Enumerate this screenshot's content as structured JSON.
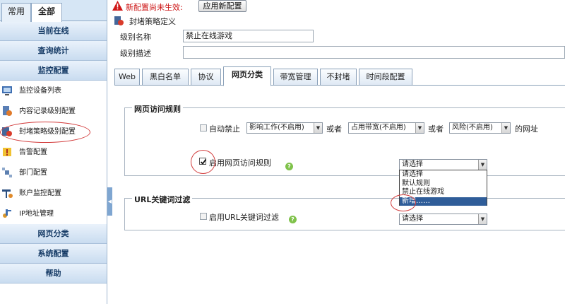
{
  "sidebar": {
    "tabs": [
      "常用",
      "全部"
    ],
    "sections": {
      "online": "当前在线",
      "stats": "查询统计",
      "monitor": "监控配置",
      "web_category": "网页分类",
      "system": "系统配置",
      "help": "帮助"
    },
    "items": [
      {
        "label": "监控设备列表",
        "icon": "monitor-icon"
      },
      {
        "label": "内容记录级别配置",
        "icon": "record-icon"
      },
      {
        "label": "封堵策略级别配置",
        "icon": "block-icon"
      },
      {
        "label": "告警配置",
        "icon": "alarm-icon"
      },
      {
        "label": "部门配置",
        "icon": "department-icon"
      },
      {
        "label": "账户监控配置",
        "icon": "account-icon"
      },
      {
        "label": "IP地址管理",
        "icon": "ip-icon"
      }
    ]
  },
  "topbar": {
    "warning": "新配置尚未生效:",
    "apply_button": "应用新配置"
  },
  "page": {
    "title": "封堵策略定义",
    "level_name_label": "级别名称",
    "level_name_value": "禁止在线游戏",
    "level_desc_label": "级别描述",
    "level_desc_value": ""
  },
  "tabs": [
    "Web",
    "黑白名单",
    "协议",
    "网页分类",
    "带宽管理",
    "不封堵",
    "时间段配置"
  ],
  "active_tab": "网页分类",
  "web_rules": {
    "legend": "网页访问规则",
    "auto_block_label": "自动禁止",
    "select1": "影响工作(不启用)",
    "or1": "或者",
    "select2": "占用带宽(不启用)",
    "or2": "或者",
    "select3": "风险(不启用)",
    "suffix": "的网址",
    "enable_label": "启用网页访问规则",
    "enable_checked": true,
    "rule_select_value": "请选择",
    "options": [
      "请选择",
      "默认规则",
      "禁止在线游戏",
      "新增……"
    ],
    "highlighted_option": "新增……"
  },
  "url_filter": {
    "legend": "URL关键词过滤",
    "enable_label": "启用URL关键词过滤",
    "enable_checked": false,
    "select_value": "请选择"
  },
  "colors": {
    "accent": "#2f5d99",
    "warning": "#cc1111",
    "annotation": "#d23b3b"
  }
}
